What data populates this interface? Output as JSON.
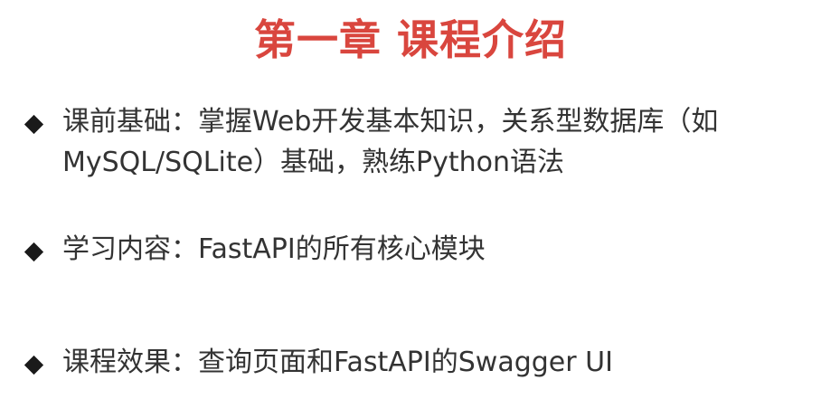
{
  "slide": {
    "title": "第一章 课程介绍",
    "bullets": [
      {
        "line1": "课前基础：掌握Web开发基本知识，关系型数据库（如",
        "line2": "MySQL/SQLite）基础，熟练Python语法"
      },
      {
        "line1": "学习内容：FastAPI的所有核心模块"
      },
      {
        "line1": "课程效果：查询页面和FastAPI的Swagger UI"
      }
    ]
  },
  "colors": {
    "title": "#d9463e",
    "body_text": "#333333",
    "bullet_marker": "#1a1a1a"
  },
  "icons": {
    "bullet_marker": "diamond-bullet-icon"
  }
}
